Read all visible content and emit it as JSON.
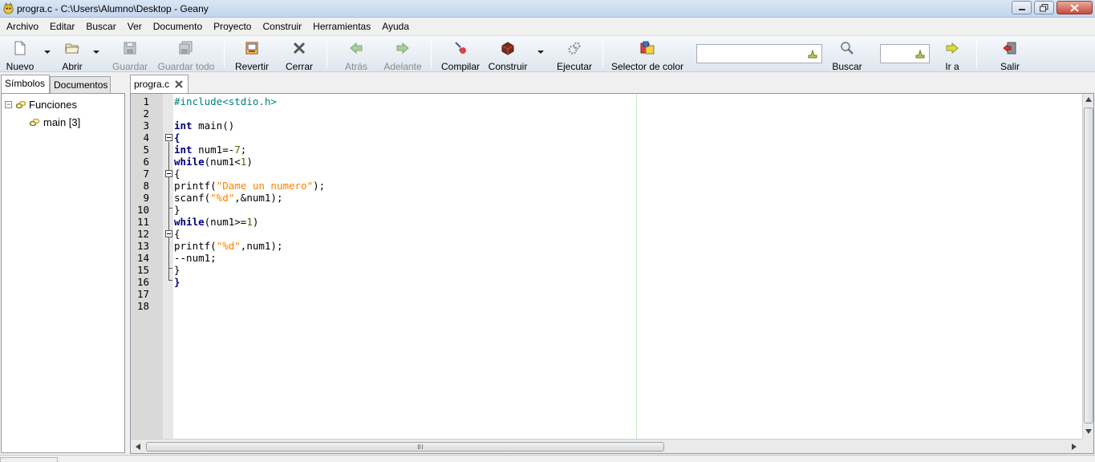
{
  "window": {
    "title": "progra.c - C:\\Users\\Alumno\\Desktop - Geany",
    "app_icon": "geany-icon"
  },
  "menubar": {
    "items": [
      "Archivo",
      "Editar",
      "Buscar",
      "Ver",
      "Documento",
      "Proyecto",
      "Construir",
      "Herramientas",
      "Ayuda"
    ]
  },
  "toolbar": {
    "nuevo": "Nuevo",
    "abrir": "Abrir",
    "guardar": "Guardar",
    "guardar_todo": "Guardar todo",
    "revertir": "Revertir",
    "cerrar": "Cerrar",
    "atras": "Atrás",
    "adelante": "Adelante",
    "compilar": "Compilar",
    "construir": "Construir",
    "ejecutar": "Ejecutar",
    "selector_color": "Selector de color",
    "search_value": "",
    "buscar": "Buscar",
    "goto_value": "",
    "ir_a": "Ir a",
    "salir": "Salir",
    "disabled_items": [
      "Guardar",
      "Guardar todo",
      "Atrás",
      "Adelante"
    ]
  },
  "sidebar": {
    "tabs": [
      "Símbolos",
      "Documentos"
    ],
    "active_tab": "Símbolos",
    "tree": {
      "group": "Funciones",
      "children": [
        "main [3]"
      ]
    }
  },
  "editor": {
    "tab_label": "progra.c",
    "line_numbers": [
      "1",
      "2",
      "3",
      "4",
      "5",
      "6",
      "7",
      "8",
      "9",
      "10",
      "11",
      "12",
      "13",
      "14",
      "15",
      "16",
      "17",
      "18"
    ],
    "lines": [
      "#include<stdio.h>",
      "",
      "int main()",
      "{",
      "int num1=-7;",
      "while(num1<1)",
      "{",
      "printf(\"Dame un numero\");",
      "scanf(\"%d\",&num1);",
      "}",
      "while(num1>=1)",
      "{",
      "printf(\"%d\",num1);",
      "--num1;",
      "}",
      "}",
      "",
      ""
    ]
  },
  "colors": {
    "keyword": "#000080",
    "preprocessor": "#008080",
    "string": "#ff8000",
    "number": "#606000",
    "gutter": "#d9d9d9",
    "long_line_marker": "#c8e6c8"
  }
}
